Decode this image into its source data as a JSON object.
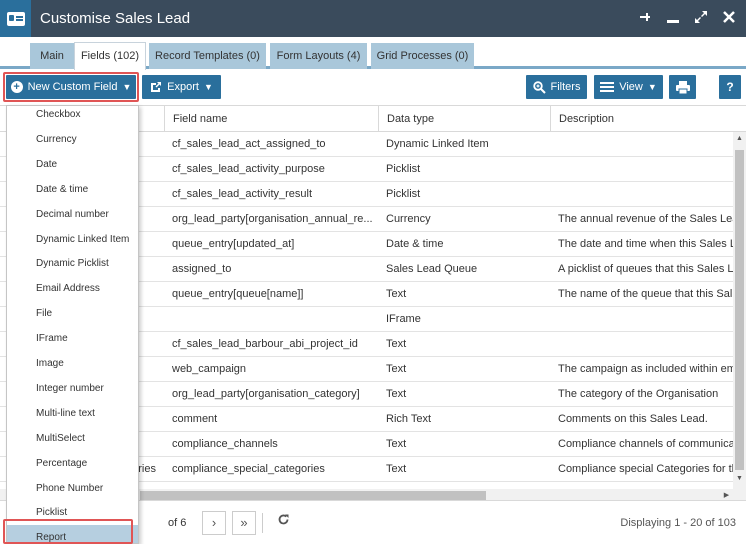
{
  "window": {
    "title": "Customise Sales Lead",
    "icons": [
      "pin-icon",
      "minimize-icon",
      "maximize-icon",
      "close-icon"
    ]
  },
  "tabs": [
    {
      "label": "Main",
      "active": false
    },
    {
      "label": "Fields (102)",
      "active": true
    },
    {
      "label": "Record Templates (0)",
      "active": false
    },
    {
      "label": "Form Layouts (4)",
      "active": false
    },
    {
      "label": "Grid Processes (0)",
      "active": false
    }
  ],
  "toolbar": {
    "new_custom_field": "New Custom Field",
    "export": "Export",
    "filters": "Filters",
    "view": "View"
  },
  "grid": {
    "columns": [
      "Field name",
      "Data type",
      "Description"
    ],
    "rows": [
      {
        "left": "",
        "field": "cf_sales_lead_act_assigned_to",
        "type": "Dynamic Linked Item",
        "desc": ""
      },
      {
        "left": "",
        "field": "cf_sales_lead_activity_purpose",
        "type": "Picklist",
        "desc": ""
      },
      {
        "left": "",
        "field": "cf_sales_lead_activity_result",
        "type": "Picklist",
        "desc": ""
      },
      {
        "left": "",
        "field": "org_lead_party[organisation_annual_re...",
        "type": "Currency",
        "desc": "The annual revenue of the Sales Lea"
      },
      {
        "left": "",
        "field": "queue_entry[updated_at]",
        "type": "Date & time",
        "desc": "The date and time when this Sales Le"
      },
      {
        "left": "",
        "field": "assigned_to",
        "type": "Sales Lead Queue",
        "desc": "A picklist of queues that this Sales L"
      },
      {
        "left": "",
        "field": "queue_entry[queue[name]]",
        "type": "Text",
        "desc": "The name of the queue that this Sal"
      },
      {
        "left": "",
        "field": "",
        "type": "IFrame",
        "desc": ""
      },
      {
        "left": "",
        "field": "cf_sales_lead_barbour_abi_project_id",
        "type": "Text",
        "desc": ""
      },
      {
        "left": "",
        "field": "web_campaign",
        "type": "Text",
        "desc": "The campaign as included within em"
      },
      {
        "left": "",
        "field": "org_lead_party[organisation_category]",
        "type": "Text",
        "desc": "The category of the Organisation"
      },
      {
        "left": "",
        "field": "comment",
        "type": "Rich Text",
        "desc": "Comments on this Sales Lead."
      },
      {
        "left": "",
        "field": "compliance_channels",
        "type": "Text",
        "desc": "Compliance channels of communica"
      },
      {
        "left": "ories",
        "field": "compliance_special_categories",
        "type": "Text",
        "desc": "Compliance special Categories for th"
      }
    ]
  },
  "dropdown": {
    "items": [
      "Checkbox",
      "Currency",
      "Date",
      "Date & time",
      "Decimal number",
      "Dynamic Linked Item",
      "Dynamic Picklist",
      "Email Address",
      "File",
      "IFrame",
      "Image",
      "Integer number",
      "Multi-line text",
      "MultiSelect",
      "Percentage",
      "Phone Number",
      "Picklist",
      "Report"
    ],
    "selected": "Report"
  },
  "pager": {
    "of_pages": "of 6",
    "displaying": "Displaying 1 - 20 of 103"
  },
  "colors": {
    "titlebar": "#3a4b5c",
    "accent": "#2a6f9c",
    "tab_inactive": "#a9c7da",
    "highlight": "#e05555"
  }
}
